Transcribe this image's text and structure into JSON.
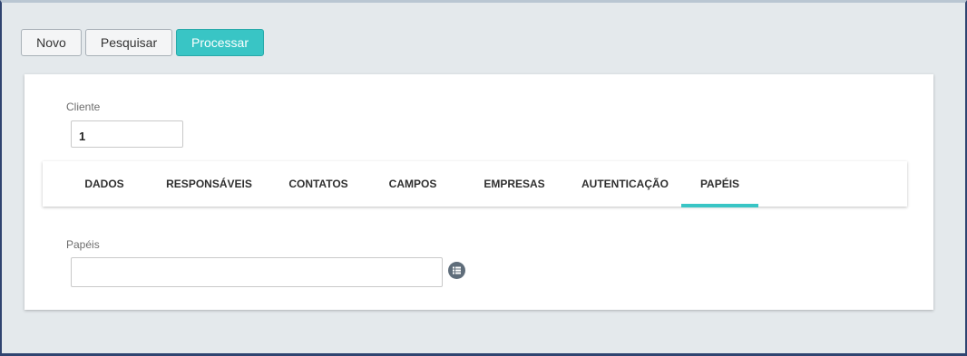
{
  "toolbar": {
    "novo_label": "Novo",
    "pesquisar_label": "Pesquisar",
    "processar_label": "Processar"
  },
  "form": {
    "cliente_label": "Cliente",
    "cliente_value": "1",
    "papeis_label": "Papéis",
    "papeis_value": ""
  },
  "tabs": [
    {
      "label": "DADOS"
    },
    {
      "label": "RESPONSÁVEIS"
    },
    {
      "label": "CONTATOS"
    },
    {
      "label": "CAMPOS"
    },
    {
      "label": "EMPRESAS"
    },
    {
      "label": "AUTENTICAÇÃO"
    },
    {
      "label": "PAPÉIS",
      "active": true
    }
  ],
  "icons": {
    "list_button": "list-icon"
  },
  "colors": {
    "accent": "#39c5c5",
    "background": "#e4e9ec",
    "panel": "#ffffff",
    "icon_button": "#5f6d7a"
  }
}
